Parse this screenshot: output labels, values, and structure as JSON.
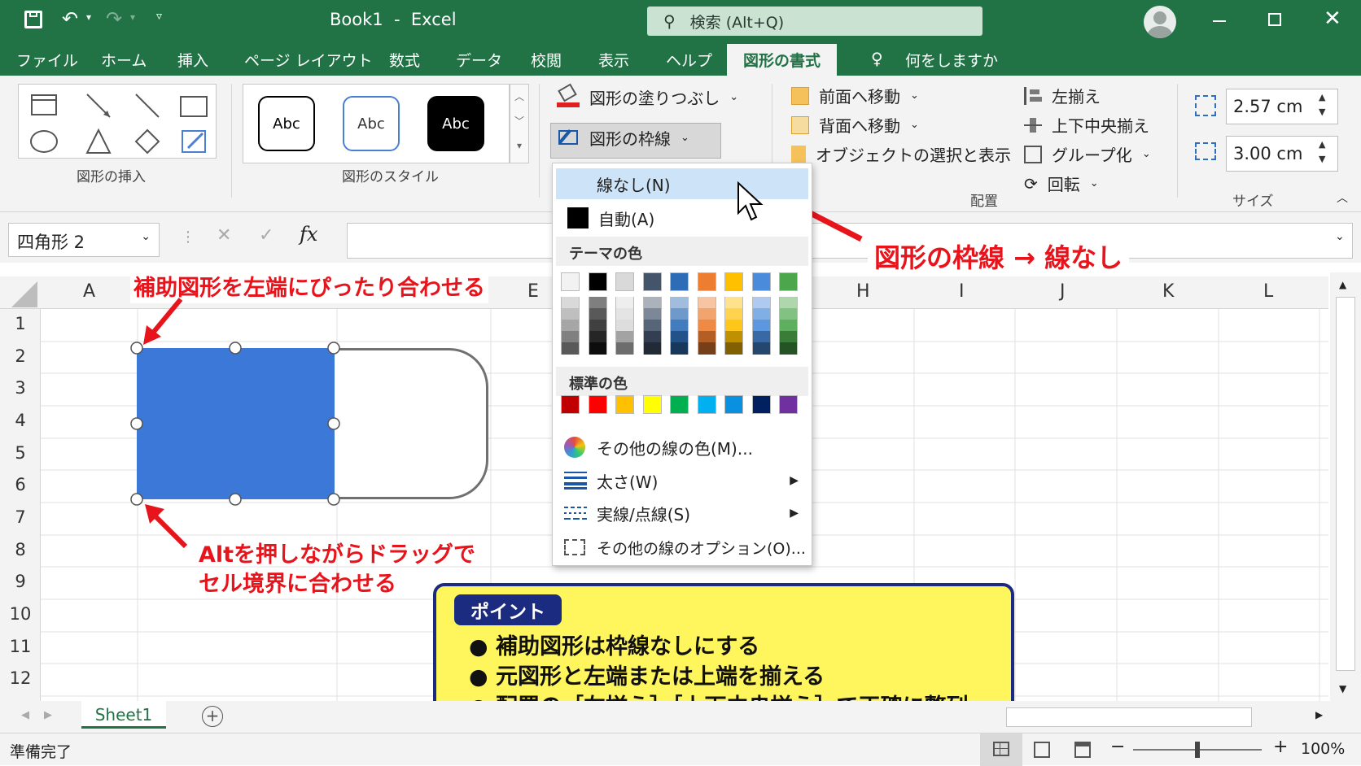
{
  "window": {
    "title": "Book1  -  Excel",
    "search_placeholder": "検索 (Alt+Q)"
  },
  "menu": {
    "tabs": [
      "ファイル",
      "ホーム",
      "挿入",
      "ページ レイアウト",
      "数式",
      "データ",
      "校閲",
      "表示",
      "ヘルプ"
    ],
    "active_tab": "図形の書式",
    "tell_me": "何をしますか"
  },
  "ribbon": {
    "insert_shapes_label": "図形の挿入",
    "styles_label": "図形のスタイル",
    "style_buttons": [
      "Abc",
      "Abc",
      "Abc"
    ],
    "fill_button": "図形の塗りつぶし",
    "outline_button": "図形の枠線",
    "bring_forward": "前面へ移動",
    "send_backward": "背面へ移動",
    "selection_pane": "オブジェクトの選択と表示",
    "arrange_label": "配置",
    "align_left": "左揃え",
    "align_middle": "上下中央揃え",
    "group": "グループ化",
    "rotate": "回転",
    "size_label": "サイズ",
    "height_value": "2.57 cm",
    "width_value": "3.00 cm"
  },
  "formula_bar": {
    "name_box": "四角形 2",
    "fx": "fx"
  },
  "columns": [
    "A",
    "E",
    "H",
    "I",
    "J",
    "K",
    "L"
  ],
  "rows": [
    "1",
    "2",
    "3",
    "4",
    "5",
    "6",
    "7",
    "8",
    "9",
    "10",
    "11",
    "12"
  ],
  "dropdown": {
    "no_outline": "線なし(N)",
    "automatic": "自動(A)",
    "theme_colors_header": "テーマの色",
    "standard_colors_header": "標準の色",
    "more_colors": "その他の線の色(M)...",
    "weight": "太さ(W)",
    "dashes": "実線/点線(S)",
    "more_options": "その他の線のオプション(O)...",
    "theme_top_row": [
      "#f2f2f2",
      "#000000",
      "#d9d9d9",
      "#44546a",
      "#2e6db5",
      "#ed7d31",
      "#ffc000",
      "#4a8cdb",
      "#4ca64c"
    ],
    "standard_row": [
      "#c00000",
      "#ff0000",
      "#ffc000",
      "#ffff00",
      "#00b050",
      "#00b0f0",
      "#0a90e0",
      "#002060",
      "#7030a0"
    ]
  },
  "annotations": {
    "top_left": "補助図形を左端にぴったり合わせる",
    "bottom_line1": "Altを押しながらドラッグで",
    "bottom_line2": "セル境界に合わせる",
    "outline_hint": "図形の枠線 → 線なし"
  },
  "point_box": {
    "title": "ポイント",
    "bullets": [
      "補助図形は枠線なしにする",
      "元図形と左端または上端を揃える",
      "配置の［左揃え］［上下中央揃え］で正確に整列"
    ]
  },
  "sheet_tab": "Sheet1",
  "status": {
    "ready": "準備完了",
    "zoom": "100%"
  }
}
